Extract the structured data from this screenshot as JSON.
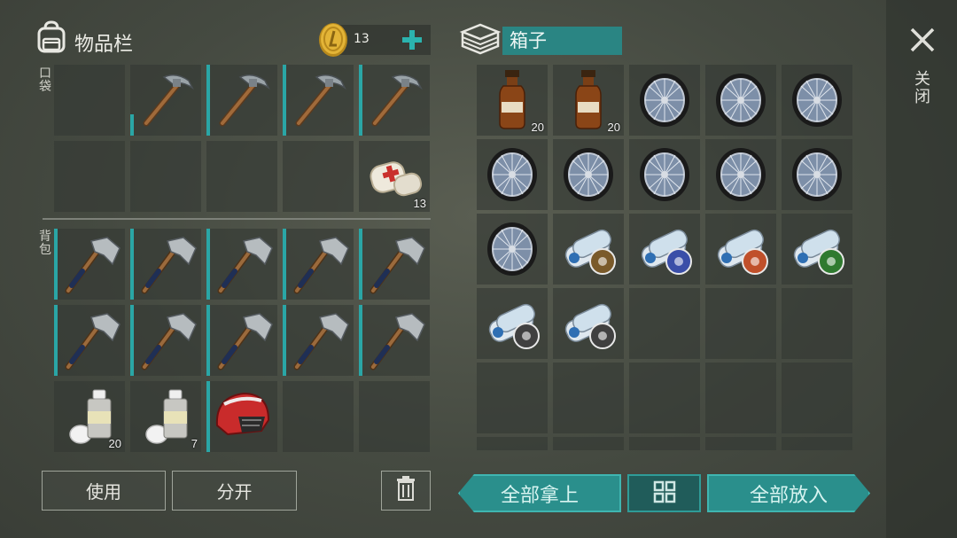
{
  "inventory": {
    "title": "物品栏",
    "coins": "13",
    "pocket_label": "口袋",
    "backpack_label": "背包",
    "pocket_slots": [
      {
        "item": "empty",
        "count": "",
        "durability": 0
      },
      {
        "item": "pickaxe-icon",
        "count": "",
        "durability": 0.3
      },
      {
        "item": "pickaxe-icon",
        "count": "",
        "durability": 1
      },
      {
        "item": "pickaxe-icon",
        "count": "",
        "durability": 1
      },
      {
        "item": "pickaxe-icon",
        "count": "",
        "durability": 1
      },
      {
        "item": "empty",
        "count": "",
        "durability": 0
      },
      {
        "item": "empty",
        "count": "",
        "durability": 0
      },
      {
        "item": "empty",
        "count": "",
        "durability": 0
      },
      {
        "item": "empty",
        "count": "",
        "durability": 0
      },
      {
        "item": "bandage-icon",
        "count": "13",
        "durability": 0
      }
    ],
    "backpack_slots": [
      {
        "item": "hatchet-icon",
        "count": "",
        "durability": 1
      },
      {
        "item": "hatchet-icon",
        "count": "",
        "durability": 1
      },
      {
        "item": "hatchet-icon",
        "count": "",
        "durability": 1
      },
      {
        "item": "hatchet-icon",
        "count": "",
        "durability": 1
      },
      {
        "item": "hatchet-icon",
        "count": "",
        "durability": 1
      },
      {
        "item": "hatchet-icon",
        "count": "",
        "durability": 1
      },
      {
        "item": "hatchet-icon",
        "count": "",
        "durability": 1
      },
      {
        "item": "hatchet-icon",
        "count": "",
        "durability": 1
      },
      {
        "item": "hatchet-icon",
        "count": "",
        "durability": 1
      },
      {
        "item": "hatchet-icon",
        "count": "",
        "durability": 1
      },
      {
        "item": "spray-paint-icon",
        "count": "20",
        "durability": 0
      },
      {
        "item": "spray-paint-icon",
        "count": "7",
        "durability": 0
      },
      {
        "item": "helmet-icon",
        "count": "",
        "durability": 1
      },
      {
        "item": "empty",
        "count": "",
        "durability": 0
      },
      {
        "item": "empty",
        "count": "",
        "durability": 0
      }
    ],
    "use_label": "使用",
    "split_label": "分开"
  },
  "box": {
    "title": "箱子",
    "slots": [
      {
        "item": "bottle-icon",
        "count": "20"
      },
      {
        "item": "bottle-icon",
        "count": "20"
      },
      {
        "item": "wheel-icon",
        "count": ""
      },
      {
        "item": "wheel-icon",
        "count": ""
      },
      {
        "item": "wheel-icon",
        "count": ""
      },
      {
        "item": "wheel-icon",
        "count": ""
      },
      {
        "item": "wheel-icon",
        "count": ""
      },
      {
        "item": "wheel-icon",
        "count": ""
      },
      {
        "item": "wheel-icon",
        "count": ""
      },
      {
        "item": "wheel-icon",
        "count": ""
      },
      {
        "item": "wheel-icon",
        "count": ""
      },
      {
        "item": "blueprint-icon",
        "count": "",
        "badge": "#7a5a2a"
      },
      {
        "item": "blueprint-icon",
        "count": "",
        "badge": "#3a4ea8"
      },
      {
        "item": "blueprint-icon",
        "count": "",
        "badge": "#c0502a"
      },
      {
        "item": "blueprint-icon",
        "count": "",
        "badge": "#2f7a2f"
      },
      {
        "item": "blueprint-icon",
        "count": "",
        "badge": "#404040"
      },
      {
        "item": "blueprint-icon",
        "count": "",
        "badge": "#404040"
      },
      {
        "item": "empty",
        "count": ""
      },
      {
        "item": "empty",
        "count": ""
      },
      {
        "item": "empty",
        "count": ""
      },
      {
        "item": "empty",
        "count": ""
      },
      {
        "item": "empty",
        "count": ""
      },
      {
        "item": "empty",
        "count": ""
      },
      {
        "item": "empty",
        "count": ""
      },
      {
        "item": "empty",
        "count": ""
      }
    ],
    "take_all_label": "全部拿上",
    "put_all_label": "全部放入"
  },
  "close_label": "关闭",
  "colors": {
    "accent": "#2aa6a6",
    "button_teal": "#2a8f8c"
  }
}
